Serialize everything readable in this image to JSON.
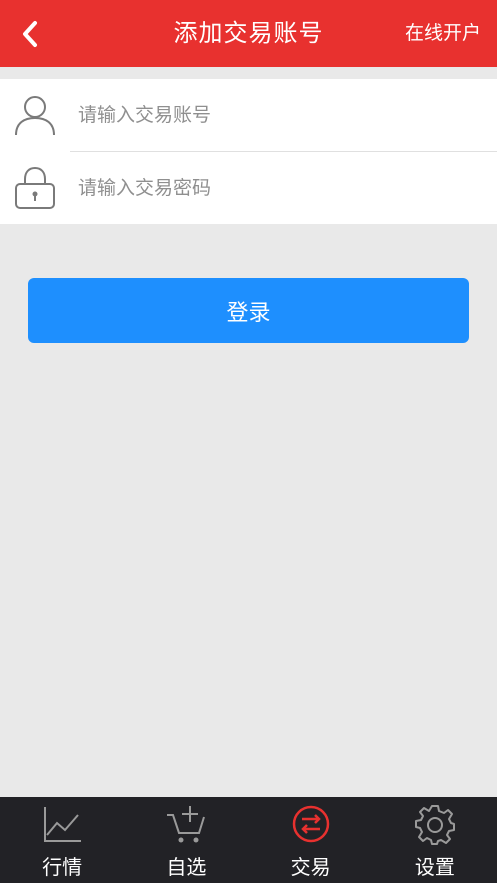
{
  "header": {
    "title": "添加交易账号",
    "right_action": "在线开户",
    "back_icon": "chevron-left-icon",
    "background_color": "#e8312f"
  },
  "form": {
    "account": {
      "icon": "user-icon",
      "placeholder": "请输入交易账号",
      "value": ""
    },
    "password": {
      "icon": "lock-icon",
      "placeholder": "请输入交易密码",
      "value": ""
    }
  },
  "login_button": {
    "label": "登录",
    "color": "#1e8ffe"
  },
  "tabbar": {
    "active_color": "#e8312f",
    "items": [
      {
        "label": "行情",
        "icon": "line-chart-icon",
        "active": false
      },
      {
        "label": "自选",
        "icon": "cart-add-icon",
        "active": false
      },
      {
        "label": "交易",
        "icon": "exchange-icon",
        "active": true
      },
      {
        "label": "设置",
        "icon": "gear-icon",
        "active": false
      }
    ]
  }
}
